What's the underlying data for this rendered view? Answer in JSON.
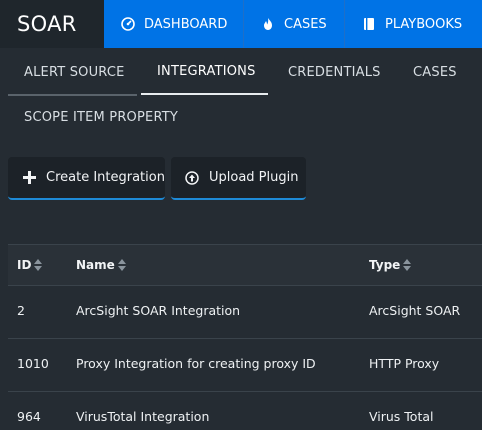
{
  "app": {
    "brand": "SOAR"
  },
  "topnav": [
    {
      "label": "DASHBOARD",
      "icon": "dashboard-gauge-icon"
    },
    {
      "label": "CASES",
      "icon": "flame-icon"
    },
    {
      "label": "PLAYBOOKS",
      "icon": "book-icon"
    }
  ],
  "tabs": [
    {
      "label": "ALERT SOURCE",
      "active": false
    },
    {
      "label": "INTEGRATIONS",
      "active": true
    },
    {
      "label": "CREDENTIALS",
      "active": false
    },
    {
      "label": "CASES",
      "active": false
    },
    {
      "label": "SCOPE ITEM PROPERTY",
      "active": false
    }
  ],
  "actions": {
    "create_label": "Create Integration",
    "upload_label": "Upload Plugin"
  },
  "table": {
    "columns": [
      "ID",
      "Name",
      "Type"
    ],
    "rows": [
      {
        "id": "2",
        "name": "ArcSight SOAR Integration",
        "type": "ArcSight SOAR"
      },
      {
        "id": "1010",
        "name": "Proxy Integration for creating proxy ID",
        "type": "HTTP Proxy"
      },
      {
        "id": "964",
        "name": "VirusTotal Integration",
        "type": "Virus Total"
      }
    ]
  },
  "colors": {
    "nav_blue": "#0073e6",
    "background": "#252c33",
    "accent_underline": "#1e8ad6"
  }
}
